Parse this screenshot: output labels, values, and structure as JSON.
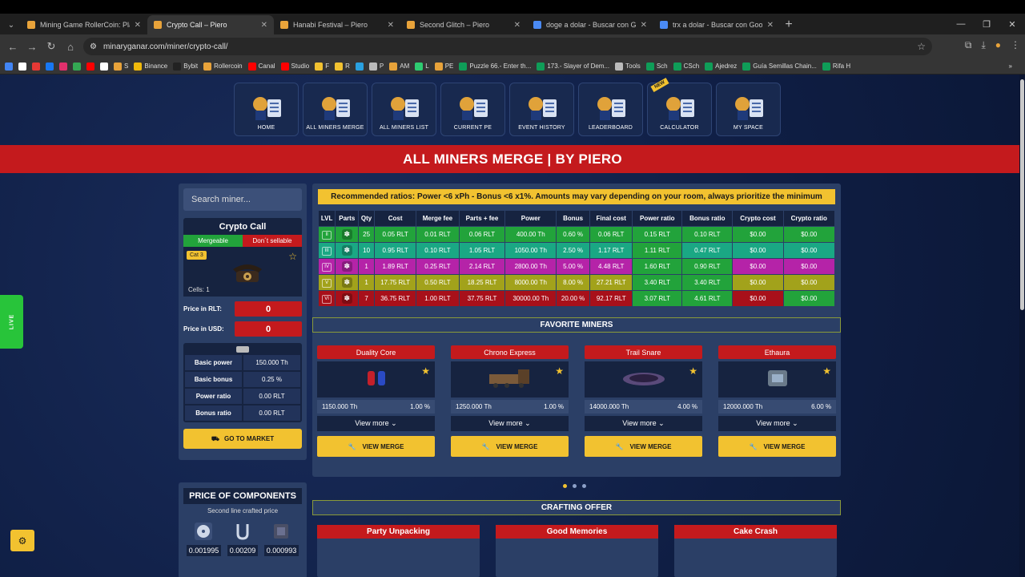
{
  "browser": {
    "tabs": [
      {
        "title": "Mining Game RollerCoin: Play M",
        "color": "#e8a33a",
        "active": false
      },
      {
        "title": "Crypto Call – Piero",
        "color": "#e8a33a",
        "active": true
      },
      {
        "title": "Hanabi Festival – Piero",
        "color": "#e8a33a",
        "active": false
      },
      {
        "title": "Second Glitch – Piero",
        "color": "#e8a33a",
        "active": false
      },
      {
        "title": "doge a dolar - Buscar con Goog",
        "color": "#4a8af4",
        "active": false
      },
      {
        "title": "trx a dolar - Buscar con Google",
        "color": "#4a8af4",
        "active": false
      }
    ],
    "url": "minaryganar.com/miner/crypto-call/",
    "bookmarks": [
      {
        "label": "",
        "color": "#4285f4"
      },
      {
        "label": "",
        "color": "#ffffff"
      },
      {
        "label": "",
        "color": "#e53935"
      },
      {
        "label": "",
        "color": "#1877f2"
      },
      {
        "label": "",
        "color": "#e1306c"
      },
      {
        "label": "",
        "color": "#34a853"
      },
      {
        "label": "",
        "color": "#ff0000"
      },
      {
        "label": "",
        "color": "#ffffff"
      },
      {
        "label": "S",
        "color": "#e8a33a"
      },
      {
        "label": "Binance",
        "color": "#f0b90b"
      },
      {
        "label": "Bybit",
        "color": "#222222"
      },
      {
        "label": "Rollercoin",
        "color": "#e8a33a"
      },
      {
        "label": "Canal",
        "color": "#ff0000"
      },
      {
        "label": "Studio",
        "color": "#ff0000"
      },
      {
        "label": "F",
        "color": "#f2c230"
      },
      {
        "label": "R",
        "color": "#f2c230"
      },
      {
        "label": "",
        "color": "#2aa1e0"
      },
      {
        "label": "P",
        "color": "#bbbbbb"
      },
      {
        "label": "AM",
        "color": "#e8a33a"
      },
      {
        "label": "L",
        "color": "#2ecc71"
      },
      {
        "label": "PE",
        "color": "#e8a33a"
      },
      {
        "label": "Puzzle 66.- Enter th...",
        "color": "#0f9d58"
      },
      {
        "label": "173.- Slayer of Dem...",
        "color": "#0f9d58"
      },
      {
        "label": "Tools",
        "color": "#bbbbbb"
      },
      {
        "label": "Sch",
        "color": "#0f9d58"
      },
      {
        "label": "CSch",
        "color": "#0f9d58"
      },
      {
        "label": "Ajedrez",
        "color": "#0f9d58"
      },
      {
        "label": "Guía Semillas Chain...",
        "color": "#0f9d58"
      },
      {
        "label": "Rifa H",
        "color": "#0f9d58"
      }
    ]
  },
  "nav": [
    {
      "label": "HOME",
      "icon": "house-icon",
      "new": false
    },
    {
      "label": "ALL MINERS MERGE",
      "icon": "wrench-icon",
      "new": false
    },
    {
      "label": "ALL MINERS LIST",
      "icon": "wrench-icon",
      "new": false
    },
    {
      "label": "CURRENT PE",
      "icon": "list-icon",
      "new": false
    },
    {
      "label": "EVENT HISTORY",
      "icon": "clock-icon",
      "new": false
    },
    {
      "label": "LEADERBOARD",
      "icon": "trophy-icon",
      "new": false
    },
    {
      "label": "CALCULATOR",
      "icon": "calculator-icon",
      "new": true,
      "badge": "NEW"
    },
    {
      "label": "MY SPACE",
      "icon": "user-icon",
      "new": false
    }
  ],
  "banner": {
    "title": "ALL MINERS MERGE | BY PIERO"
  },
  "search": {
    "placeholder": "Search miner..."
  },
  "miner": {
    "name": "Crypto Call",
    "tag_mergeable": "Mergeable",
    "tag_sellable": "Don´t sellable",
    "category": "Cat 3",
    "cells": "Cells: 1",
    "price_rlt_label": "Price in RLT:",
    "price_rlt": "0",
    "price_usd_label": "Price in USD:",
    "price_usd": "0",
    "stats": [
      {
        "label": "Basic power",
        "value": "150.000 Th"
      },
      {
        "label": "Basic bonus",
        "value": "0.25 %"
      },
      {
        "label": "Power ratio",
        "value": "0.00 RLT"
      },
      {
        "label": "Bonus ratio",
        "value": "0.00 RLT"
      }
    ],
    "market_button": "GO TO MARKET"
  },
  "components": {
    "title": "PRICE OF COMPONENTS",
    "subtitle": "Second line crafted price",
    "items": [
      {
        "name": "fan-icon",
        "value": "0.001995"
      },
      {
        "name": "wire-icon",
        "value": "0.00209"
      },
      {
        "name": "chip-icon",
        "value": "0.000993"
      }
    ]
  },
  "ratio_note": "Recommended ratios: Power <6 xPh - Bonus <6 x1%. Amounts may vary depending on your room, always prioritize the minimum",
  "merge_table": {
    "headers": [
      "LVL",
      "Parts",
      "Qty",
      "Cost",
      "Merge fee",
      "Parts + fee",
      "Power",
      "Bonus",
      "Final cost",
      "Power ratio",
      "Bonus ratio",
      "Crypto cost",
      "Crypto ratio"
    ],
    "rows": [
      {
        "lvl": "II",
        "part": "✽",
        "qty": "25",
        "cost": "0.05 RLT",
        "fee": "0.01 RLT",
        "pf": "0.06 RLT",
        "power": "400.00 Th",
        "bonus": "0.60 %",
        "final": "0.06 RLT",
        "pr": "0.15 RLT",
        "br": "0.10 RLT",
        "cc": "$0.00",
        "cr": "$0.00",
        "color": "green"
      },
      {
        "lvl": "III",
        "part": "✽",
        "qty": "10",
        "cost": "0.95 RLT",
        "fee": "0.10 RLT",
        "pf": "1.05 RLT",
        "power": "1050.00 Th",
        "bonus": "2.50 %",
        "final": "1.17 RLT",
        "pr": "1.11 RLT",
        "br": "0.47 RLT",
        "cc": "$0.00",
        "cr": "$0.00",
        "color": "teal"
      },
      {
        "lvl": "IV",
        "part": "✽",
        "qty": "1",
        "cost": "1.89 RLT",
        "fee": "0.25 RLT",
        "pf": "2.14 RLT",
        "power": "2800.00 Th",
        "bonus": "5.00 %",
        "final": "4.48 RLT",
        "pr": "1.60 RLT",
        "br": "0.90 RLT",
        "cc": "$0.00",
        "cr": "$0.00",
        "color": "mag"
      },
      {
        "lvl": "V",
        "part": "✽",
        "qty": "1",
        "cost": "17.75 RLT",
        "fee": "0.50 RLT",
        "pf": "18.25 RLT",
        "power": "8000.00 Th",
        "bonus": "8.00 %",
        "final": "27.21 RLT",
        "pr": "3.40 RLT",
        "br": "3.40 RLT",
        "cc": "$0.00",
        "cr": "$0.00",
        "color": "olive"
      },
      {
        "lvl": "VI",
        "part": "✽",
        "qty": "7",
        "cost": "36.75 RLT",
        "fee": "1.00 RLT",
        "pf": "37.75 RLT",
        "power": "30000.00 Th",
        "bonus": "20.00 %",
        "final": "92.17 RLT",
        "pr": "3.07 RLT",
        "br": "4.61 RLT",
        "cc": "$0.00",
        "cr": "$0.00",
        "color": "red"
      }
    ]
  },
  "favorites": {
    "title": "FAVORITE MINERS",
    "items": [
      {
        "name": "Duality Core",
        "power": "1150.000 Th",
        "bonus": "1.00 %",
        "more": "View more",
        "button": "VIEW MERGE"
      },
      {
        "name": "Chrono Express",
        "power": "1250.000 Th",
        "bonus": "1.00 %",
        "more": "View more",
        "button": "VIEW MERGE"
      },
      {
        "name": "Trail Snare",
        "power": "14000.000 Th",
        "bonus": "4.00 %",
        "more": "View more",
        "button": "VIEW MERGE"
      },
      {
        "name": "Ethaura",
        "power": "12000.000 Th",
        "bonus": "6.00 %",
        "more": "View more",
        "button": "VIEW MERGE"
      }
    ]
  },
  "crafting": {
    "title": "CRAFTING OFFER",
    "items": [
      "Party Unpacking",
      "Good Memories",
      "Cake Crash"
    ]
  },
  "live_label": "LIVE",
  "colors": {
    "accent_yellow": "#f2c230",
    "brand_red": "#c41a1d",
    "green": "#22a33b"
  }
}
